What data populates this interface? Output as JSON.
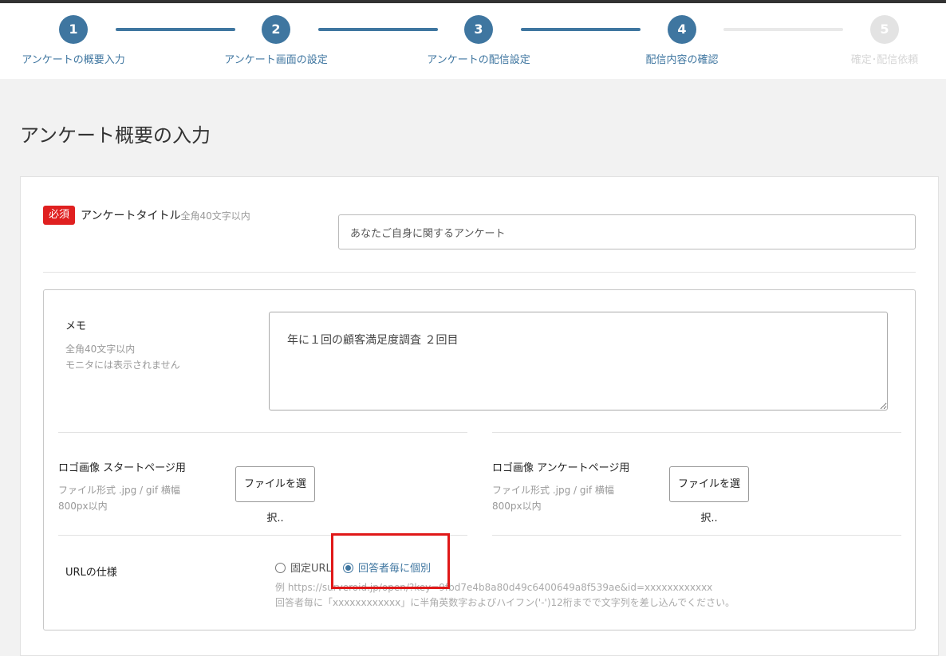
{
  "stepper": {
    "steps": [
      {
        "number": "1",
        "label": "アンケートの概要入力"
      },
      {
        "number": "2",
        "label": "アンケート画面の設定"
      },
      {
        "number": "3",
        "label": "アンケートの配信設定"
      },
      {
        "number": "4",
        "label": "配信内容の確認"
      },
      {
        "number": "5",
        "label": "確定･配信依頼"
      }
    ],
    "active_color": "#3f76a0",
    "inactive_color": "#e3e3e3"
  },
  "page": {
    "title": "アンケート概要の入力"
  },
  "survey_title": {
    "required_badge": "必須",
    "label": "アンケートタイトル",
    "hint": "全角40文字以内",
    "value": "あなたご自身に関するアンケート"
  },
  "memo": {
    "label": "メモ",
    "hint_line1": "全角40文字以内",
    "hint_line2": "モニタには表示されません",
    "value": "年に１回の顧客満足度調査 ２回目"
  },
  "logo_start": {
    "label": "ロゴ画像 スタートページ用",
    "hint": "ファイル形式 .jpg / gif 横幅800px以内",
    "button_label": "ファイルを選択.."
  },
  "logo_survey": {
    "label": "ロゴ画像 アンケートページ用",
    "hint": "ファイル形式 .jpg / gif 横幅800px以内",
    "button_label": "ファイルを選択.."
  },
  "url_spec": {
    "label": "URLの仕様",
    "options": [
      {
        "label": "固定URL",
        "selected": false
      },
      {
        "label": "回答者毎に個別",
        "selected": true
      }
    ],
    "example": "例 https://surveroid.jp/open/?key=9fbd7e4b8a80d49c6400649a8f539ae&id=xxxxxxxxxxxx",
    "note": "回答者毎に「xxxxxxxxxxxx」に半角英数字およびハイフン('-')12桁までで文字列を差し込んでください。"
  },
  "colors": {
    "required_badge": "#e02020",
    "highlight": "#e01818",
    "accent": "#3f76a0"
  }
}
